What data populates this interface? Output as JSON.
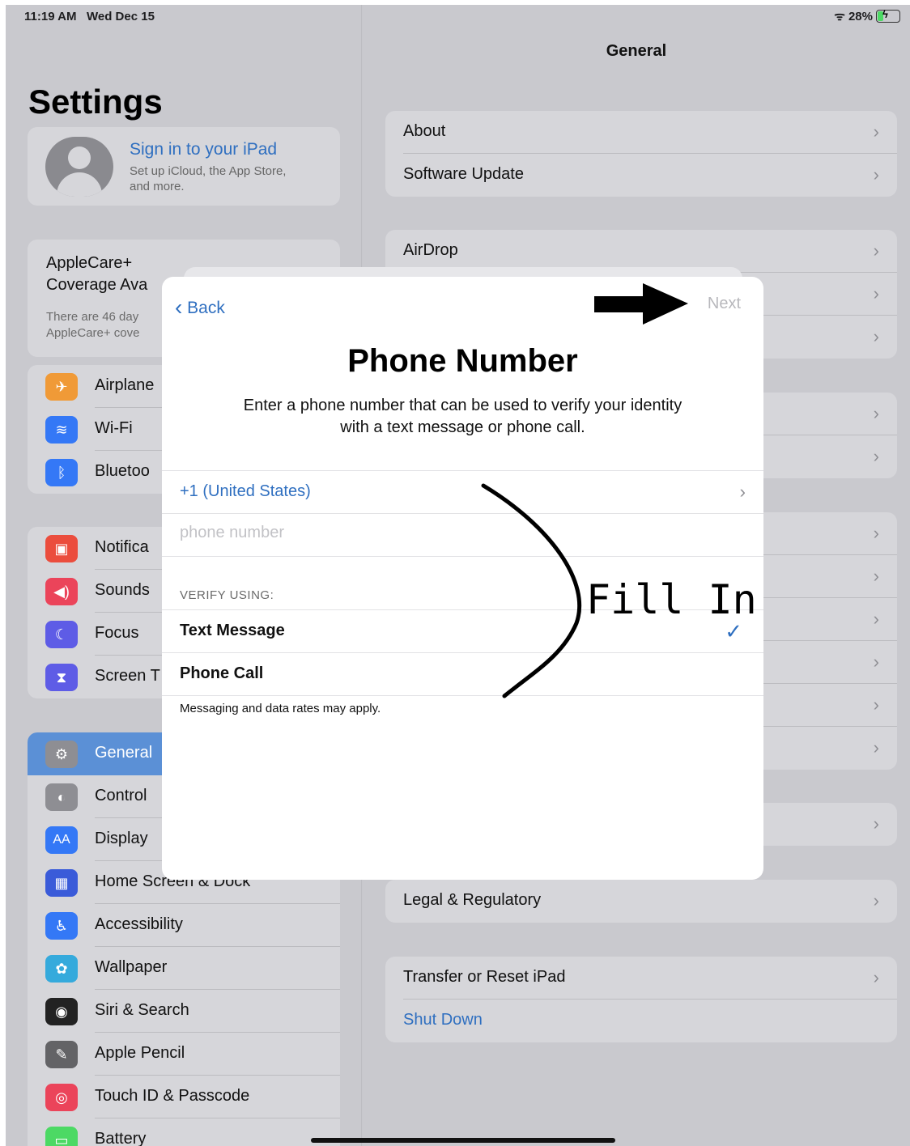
{
  "status": {
    "time": "11:19 AM",
    "date": "Wed Dec 15",
    "battery": "28%",
    "battery_level": 0.28
  },
  "sidebar": {
    "title": "Settings",
    "account": {
      "name": "Sign in to your iPad",
      "sub": "Set up iCloud, the App Store, and more."
    },
    "applecare": {
      "title_line1": "AppleCare+",
      "title_line2": "Coverage Ava",
      "desc_line1": "There are 46 day",
      "desc_line2": "AppleCare+ cove"
    },
    "group1": [
      {
        "label": "Airplane",
        "icon": "airplane-icon",
        "color": "#f09a37"
      },
      {
        "label": "Wi-Fi",
        "icon": "wifi-icon",
        "color": "#3478f6"
      },
      {
        "label": "Bluetoo",
        "icon": "bluetooth-icon",
        "color": "#3478f6"
      }
    ],
    "group2": [
      {
        "label": "Notifica",
        "icon": "notifications-icon",
        "color": "#eb4d3d"
      },
      {
        "label": "Sounds",
        "icon": "sounds-icon",
        "color": "#eb445a"
      },
      {
        "label": "Focus",
        "icon": "focus-moon-icon",
        "color": "#5e5ce6"
      },
      {
        "label": "Screen T",
        "icon": "screen-time-icon",
        "color": "#5e5ce6"
      }
    ],
    "group3": [
      {
        "label": "General",
        "icon": "gear-icon",
        "color": "#8e8e93"
      },
      {
        "label": "Control",
        "icon": "control-center-icon",
        "color": "#8e8e93"
      },
      {
        "label": "Display",
        "icon": "display-icon",
        "color": "#3478f6",
        "glyph": "AA"
      },
      {
        "label": "Home Screen & Dock",
        "icon": "home-screen-icon",
        "color": "#3a5bd9"
      },
      {
        "label": "Accessibility",
        "icon": "accessibility-icon",
        "color": "#3478f6"
      },
      {
        "label": "Wallpaper",
        "icon": "wallpaper-icon",
        "color": "#35aadc"
      },
      {
        "label": "Siri & Search",
        "icon": "siri-icon",
        "color": "#222222"
      },
      {
        "label": "Apple Pencil",
        "icon": "pencil-icon",
        "color": "#636366"
      },
      {
        "label": "Touch ID & Passcode",
        "icon": "fingerprint-icon",
        "color": "#eb445a"
      },
      {
        "label": "Battery",
        "icon": "battery-icon",
        "color": "#4cd964"
      }
    ]
  },
  "main": {
    "header": "General",
    "group1": [
      "About",
      "Software Update"
    ],
    "group2": [
      "AirDrop"
    ],
    "legal": "Legal & Regulatory",
    "transfer": "Transfer or Reset iPad",
    "shutdown": "Shut Down"
  },
  "sheet": {
    "back": "Back",
    "next": "Next",
    "title": "Phone Number",
    "desc_line1": "Enter a phone number that can be used to verify your identity",
    "desc_line2": "with a text message or phone call.",
    "country": "+1 (United States)",
    "phone_placeholder": "phone number",
    "verify_header": "VERIFY USING:",
    "option_text": "Text Message",
    "option_call": "Phone Call",
    "note": "Messaging and data rates may apply."
  },
  "annotation": {
    "label": "Fill In"
  },
  "colors": {
    "accent": "#2f6fc0",
    "selected": "#5b90d6"
  }
}
